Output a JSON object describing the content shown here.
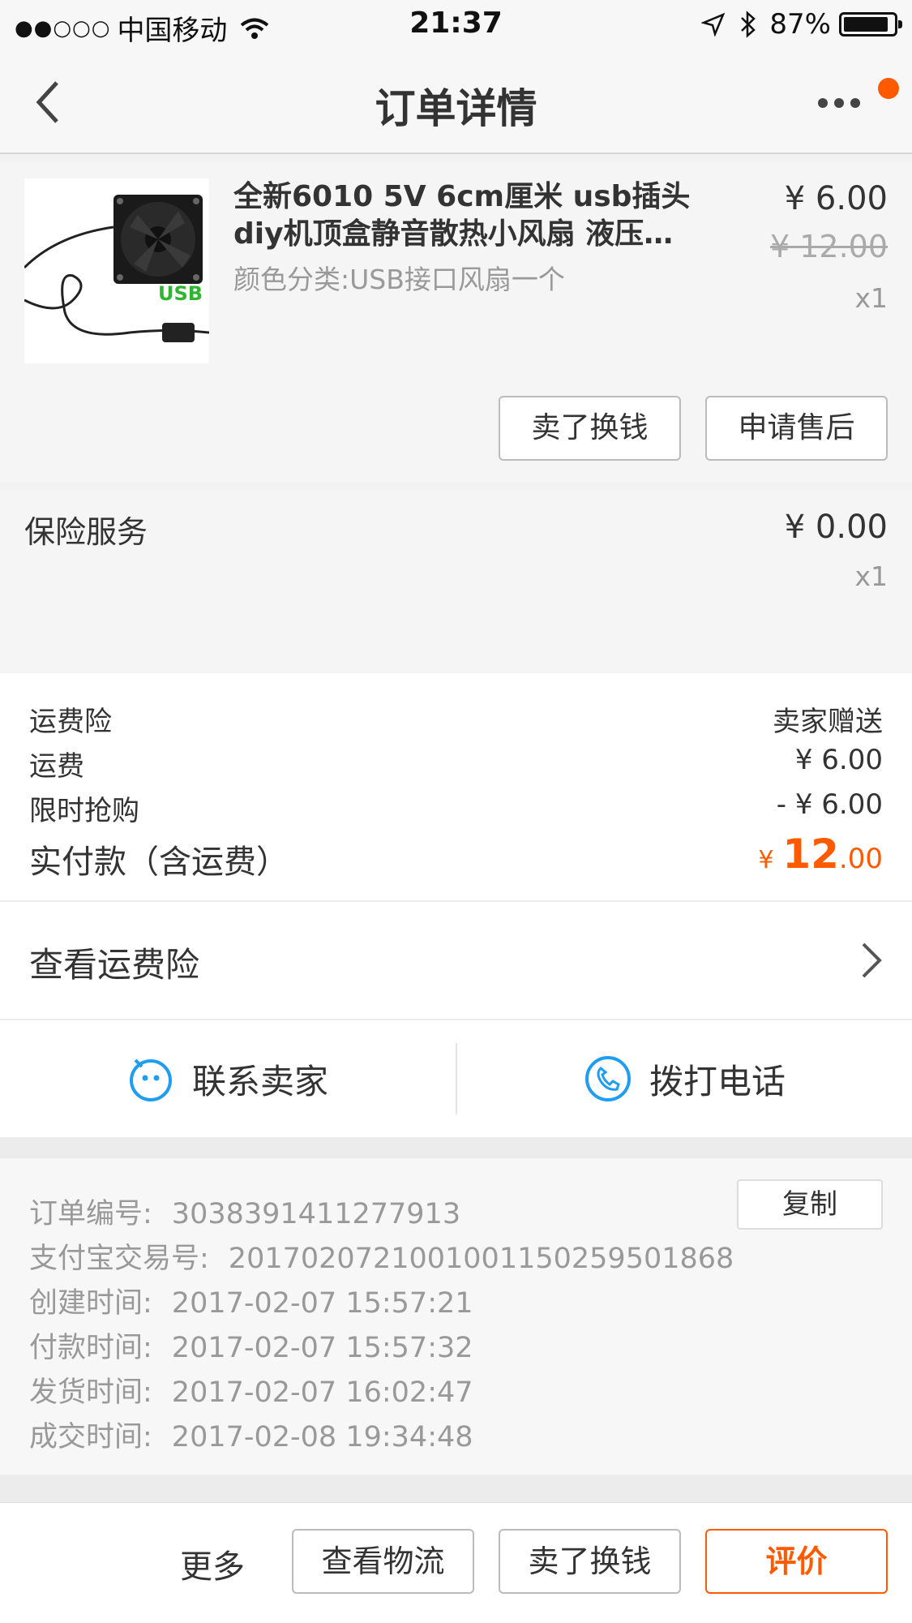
{
  "status_bar": {
    "carrier": "中国移动",
    "time": "21:37",
    "battery": "87%"
  },
  "nav": {
    "title": "订单详情"
  },
  "product": {
    "title": "全新6010 5V  6cm厘米 usb插头diy机顶盒静音散热小风扇 液压…",
    "thumb_text": "USB",
    "sku": "颜色分类:USB接口风扇一个",
    "price": "¥ 6.00",
    "original_price": "¥ 12.00",
    "quantity": "x1",
    "buttons": {
      "resell": "卖了换钱",
      "after_sale": "申请售后"
    }
  },
  "insurance": {
    "label": "保险服务",
    "price": "¥ 0.00",
    "quantity": "x1"
  },
  "summary": {
    "rows": [
      {
        "label": "运费险",
        "value": "卖家赠送"
      },
      {
        "label": "运费",
        "value": "¥ 6.00"
      },
      {
        "label": "限时抢购",
        "value": "- ¥ 6.00"
      }
    ],
    "total_label": "实付款（含运费）",
    "total": {
      "currency": "¥",
      "integer": "12",
      "decimal": ".00"
    }
  },
  "view_insurance": {
    "label": "查看运费险"
  },
  "contact": {
    "seller": "联系卖家",
    "phone": "拨打电话"
  },
  "order_info": {
    "copy_label": "复制",
    "rows": [
      {
        "label": "订单编号:",
        "value": "3038391411277913"
      },
      {
        "label": "支付宝交易号:",
        "value": "2017020721001001150259501868"
      },
      {
        "label": "创建时间:",
        "value": "2017-02-07 15:57:21"
      },
      {
        "label": "付款时间:",
        "value": "2017-02-07 15:57:32"
      },
      {
        "label": "发货时间:",
        "value": "2017-02-07 16:02:47"
      },
      {
        "label": "成交时间:",
        "value": "2017-02-08 19:34:48"
      }
    ]
  },
  "bottom_bar": {
    "more": "更多",
    "logistics": "查看物流",
    "resell": "卖了换钱",
    "review": "评价"
  },
  "colors": {
    "accent": "#ff5a00",
    "contact_icon": "#1e9df2"
  }
}
